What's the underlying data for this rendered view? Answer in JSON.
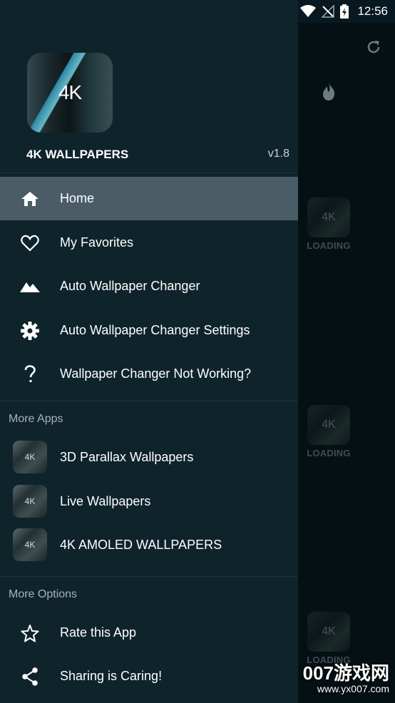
{
  "status_bar": {
    "time": "12:56"
  },
  "header": {
    "logo_text": "4K",
    "app_name": "4K WALLPAPERS",
    "version": "v1.8"
  },
  "menu": [
    {
      "label": "Home",
      "icon": "home-icon",
      "active": true
    },
    {
      "label": "My Favorites",
      "icon": "heart-icon"
    },
    {
      "label": "Auto Wallpaper Changer",
      "icon": "landscape-icon"
    },
    {
      "label": "Auto Wallpaper Changer Settings",
      "icon": "gear-icon"
    },
    {
      "label": "Wallpaper Changer Not Working?",
      "icon": "question-icon"
    }
  ],
  "more_apps": {
    "title": "More Apps",
    "items": [
      {
        "label": "3D Parallax Wallpapers",
        "thumb_text": "4K"
      },
      {
        "label": "Live Wallpapers",
        "thumb_text": "4K"
      },
      {
        "label": "4K AMOLED WALLPAPERS",
        "thumb_text": "4K"
      }
    ]
  },
  "more_options": {
    "title": "More Options",
    "items": [
      {
        "label": "Rate this App",
        "icon": "star-icon"
      },
      {
        "label": "Sharing is Caring!",
        "icon": "share-icon"
      }
    ]
  },
  "background": {
    "loading_label": "LOADING",
    "thumb_text": "4K"
  },
  "watermark": {
    "main": "007游戏网",
    "url": "www.yx007.com"
  },
  "colors": {
    "drawer_bg": "#0f232b",
    "active_item": "#4a5d66",
    "backdrop": "#051015"
  }
}
